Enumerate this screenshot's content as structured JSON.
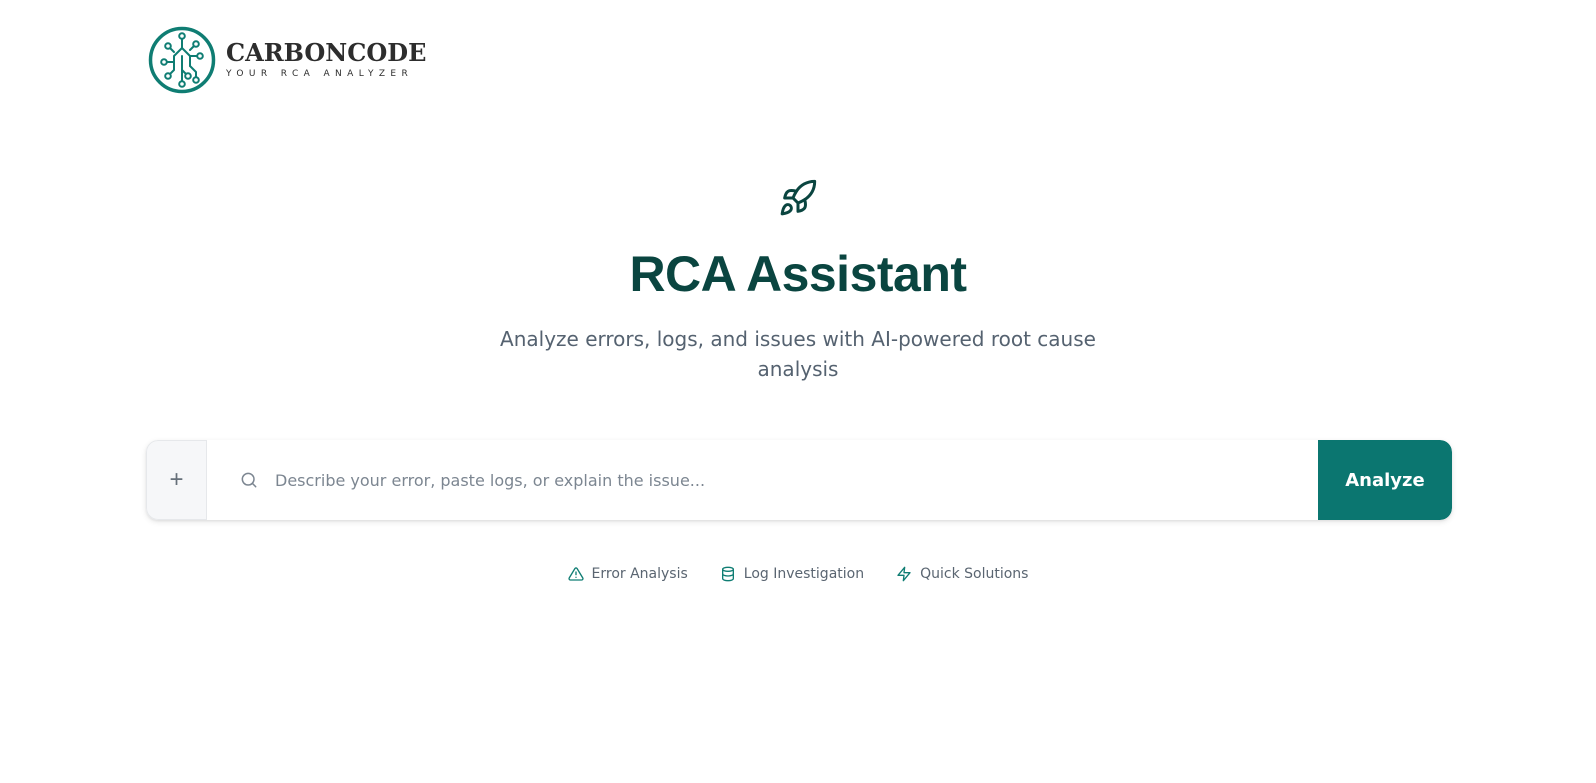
{
  "brand": {
    "name": "CARBONCODE",
    "tagline": "YOUR RCA ANALYZER",
    "icon": "circuit-logo-icon",
    "color": "#0f7d73"
  },
  "hero": {
    "icon": "rocket-icon",
    "title": "RCA Assistant",
    "subtitle": "Analyze errors, logs, and issues with AI-powered root cause analysis"
  },
  "search": {
    "add_label": "+",
    "icon": "search-icon",
    "placeholder": "Describe your error, paste logs, or explain the issue...",
    "value": "",
    "submit_label": "Analyze"
  },
  "chips": [
    {
      "label": "Error Analysis",
      "icon": "warning-triangle-icon"
    },
    {
      "label": "Log Investigation",
      "icon": "database-icon"
    },
    {
      "label": "Quick Solutions",
      "icon": "lightning-icon"
    }
  ],
  "colors": {
    "accent": "#0b7670",
    "title": "#0a4540",
    "muted": "#556270"
  }
}
